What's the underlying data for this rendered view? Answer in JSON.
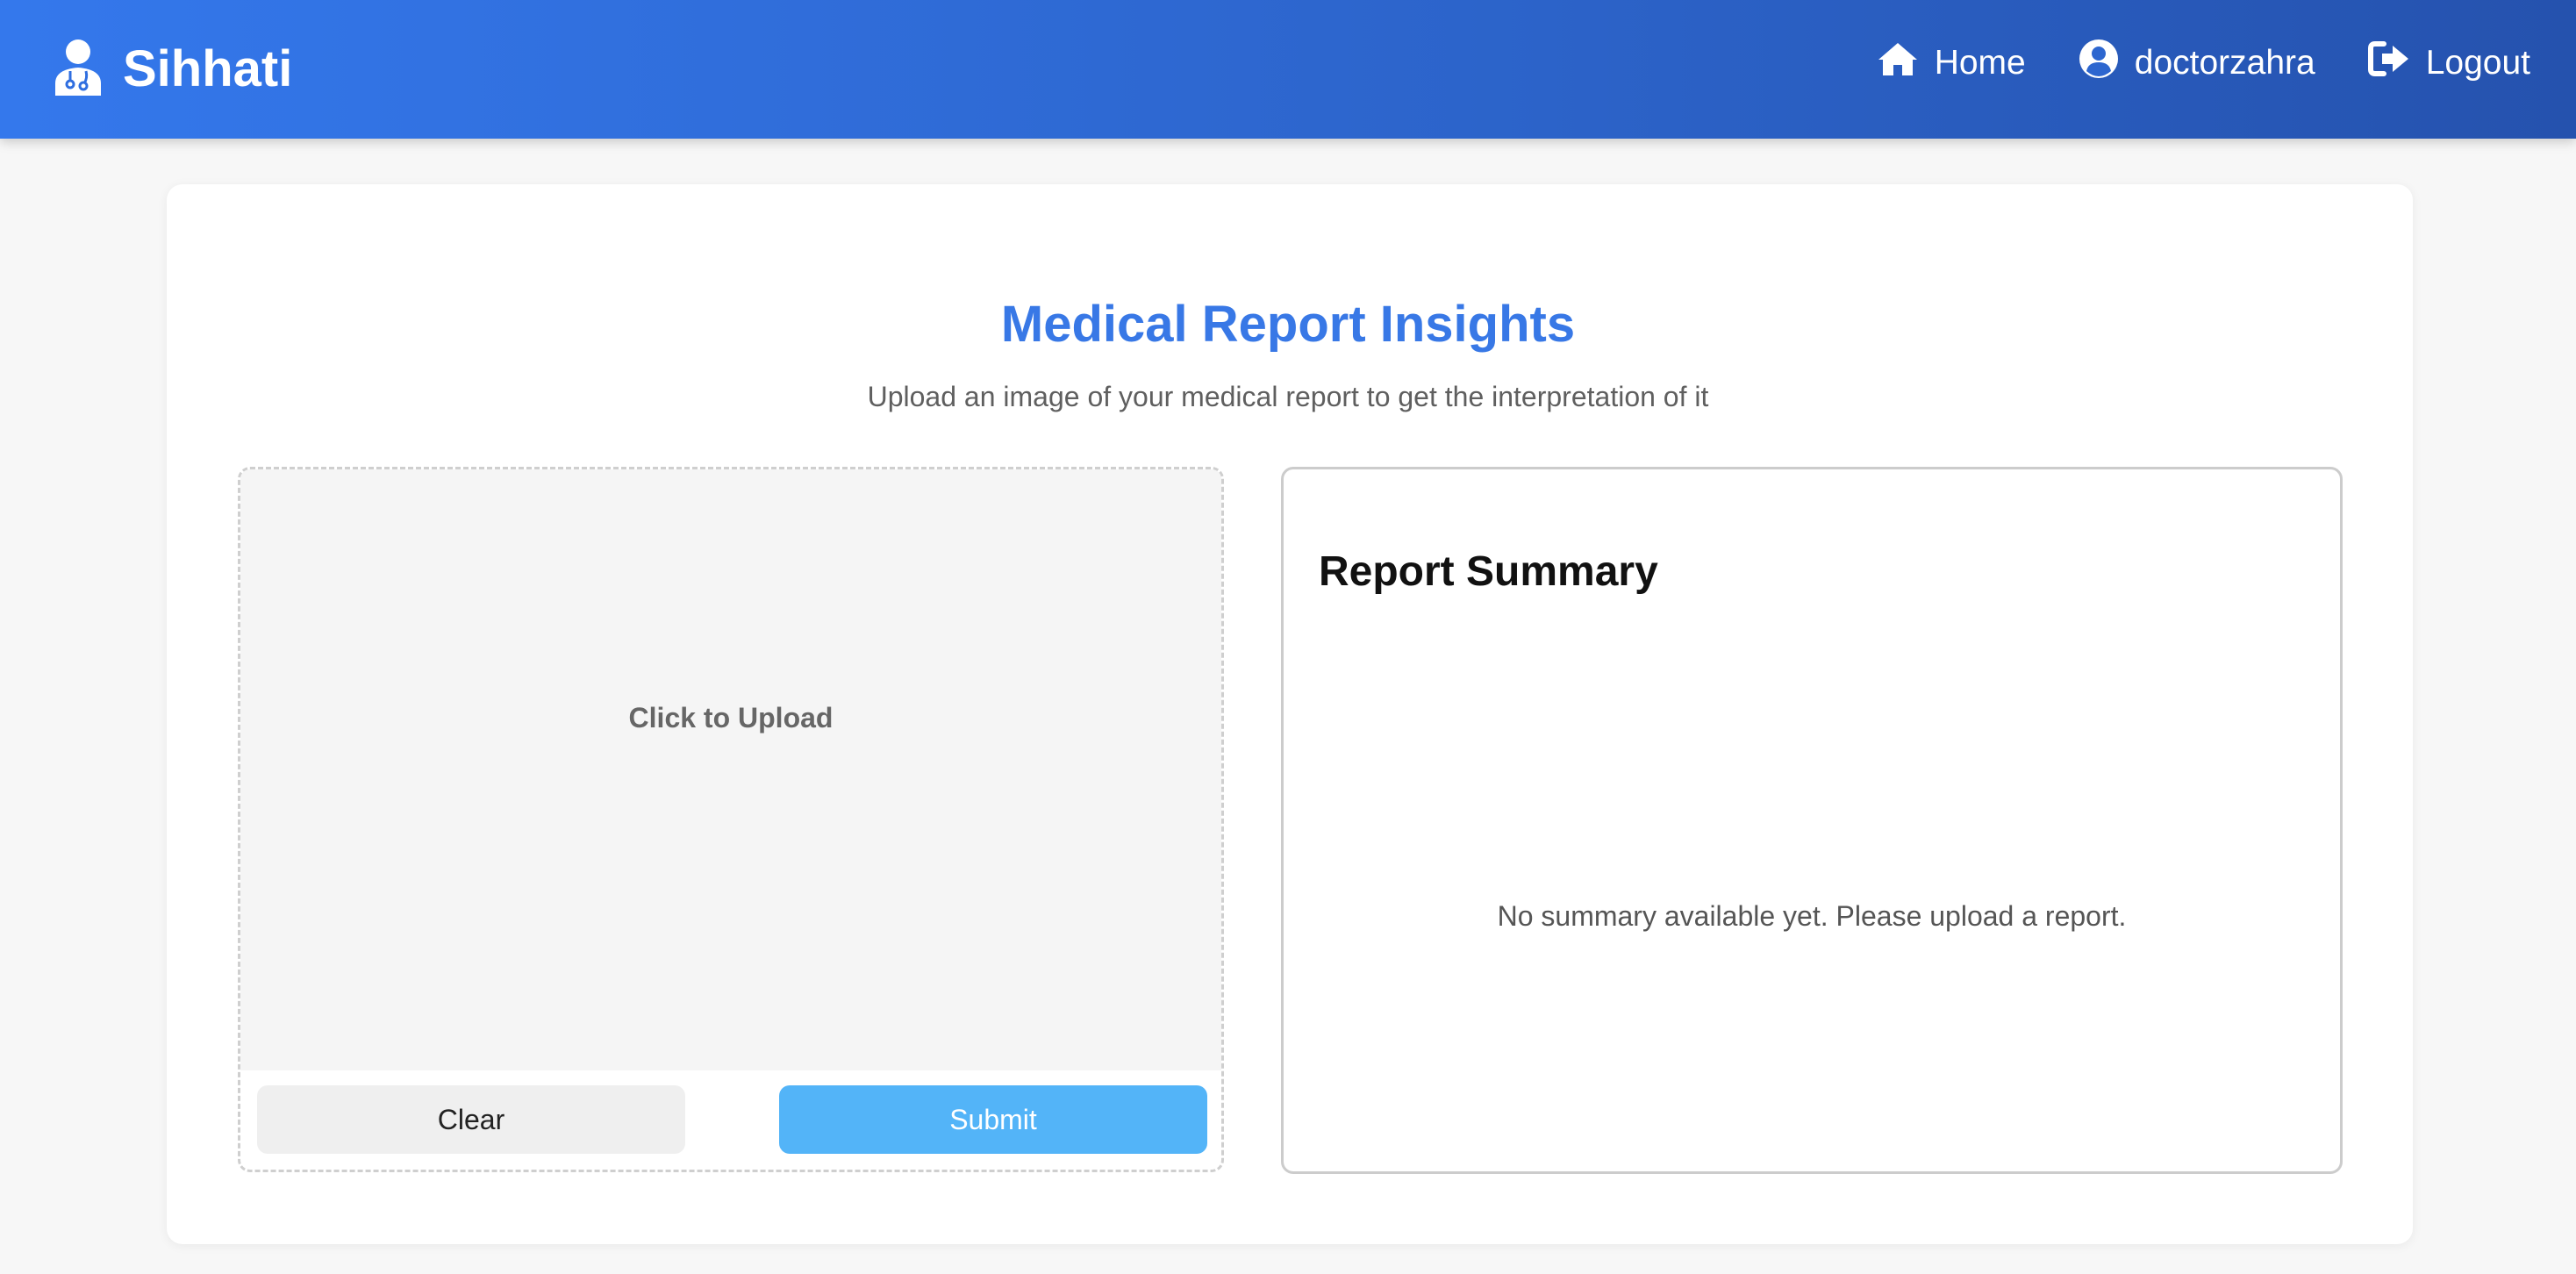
{
  "navbar": {
    "brand": "Sihhati",
    "brand_icon": "user-doctor-icon",
    "links": [
      {
        "label": "Home",
        "icon": "home-icon"
      },
      {
        "label": "doctorzahra",
        "icon": "user-circle-icon"
      },
      {
        "label": "Logout",
        "icon": "sign-out-icon"
      }
    ]
  },
  "page": {
    "title": "Medical Report Insights",
    "subtitle": "Upload an image of your medical report to get the interpretation of it"
  },
  "upload": {
    "prompt": "Click to Upload",
    "clear_label": "Clear",
    "submit_label": "Submit"
  },
  "summary": {
    "title": "Report Summary",
    "empty_text": "No summary available yet. Please upload a report."
  },
  "colors": {
    "header_gradient_start": "#3478ec",
    "header_gradient_end": "#2552ae",
    "title_blue": "#3878e6",
    "submit_blue": "#53b4f8"
  }
}
